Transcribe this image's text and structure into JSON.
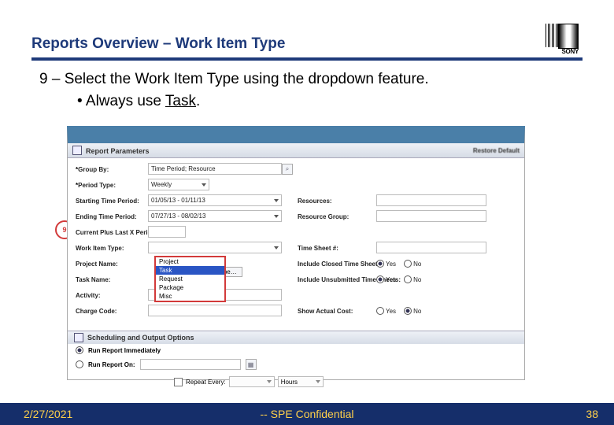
{
  "slide": {
    "title": "Reports Overview – Work Item Type",
    "step_text": "9 – Select the Work Item Type using the dropdown feature.",
    "bullet_prefix": "Always use ",
    "bullet_emph": "Task",
    "bullet_suffix": ".",
    "callout_num": "9"
  },
  "logo": {
    "brand": "SONY"
  },
  "footer": {
    "date": "2/27/2021",
    "confidential": "-- SPE Confidential",
    "page": "38"
  },
  "screenshot": {
    "window_tab": "",
    "panel_title": "Report Parameters",
    "restore_btn": "Restore Default",
    "labels": {
      "group_by": "Group By:",
      "period_type": "Period Type:",
      "start": "Starting Time Period:",
      "end": "Ending Time Period:",
      "plus_last": "Current Plus Last X Periods:",
      "wit": "Work Item Type:",
      "proj": "Project Name:",
      "task": "Task Name:",
      "activity": "Activity:",
      "charge": "Charge Code:",
      "resources": "Resources:",
      "res_group": "Resource Group:",
      "timesheet": "Time Sheet #:",
      "inc_closed": "Include Closed Time Sheets:",
      "inc_unsub": "Include Unsubmitted Time Sheets:",
      "show_actual": "Show Actual Cost:"
    },
    "values": {
      "group_by": "Time Period; Resource",
      "period_type": "Weekly",
      "start": "01/05/13 - 01/11/13",
      "end": "07/27/13 - 08/02/13",
      "plus_last": "",
      "wit_btn": "Work Item Type…",
      "yes": "Yes",
      "no": "No"
    },
    "dropdown": {
      "opt1": "Project",
      "opt2": "Task",
      "opt3": "Request",
      "opt4": "Package",
      "opt5": "Misc"
    },
    "sched_title": "Scheduling and Output Options",
    "run_now": "Run Report Immediately",
    "run_on": "Run Report On:",
    "repeat": "Repeat Every:",
    "repeat_unit": "Hours"
  }
}
